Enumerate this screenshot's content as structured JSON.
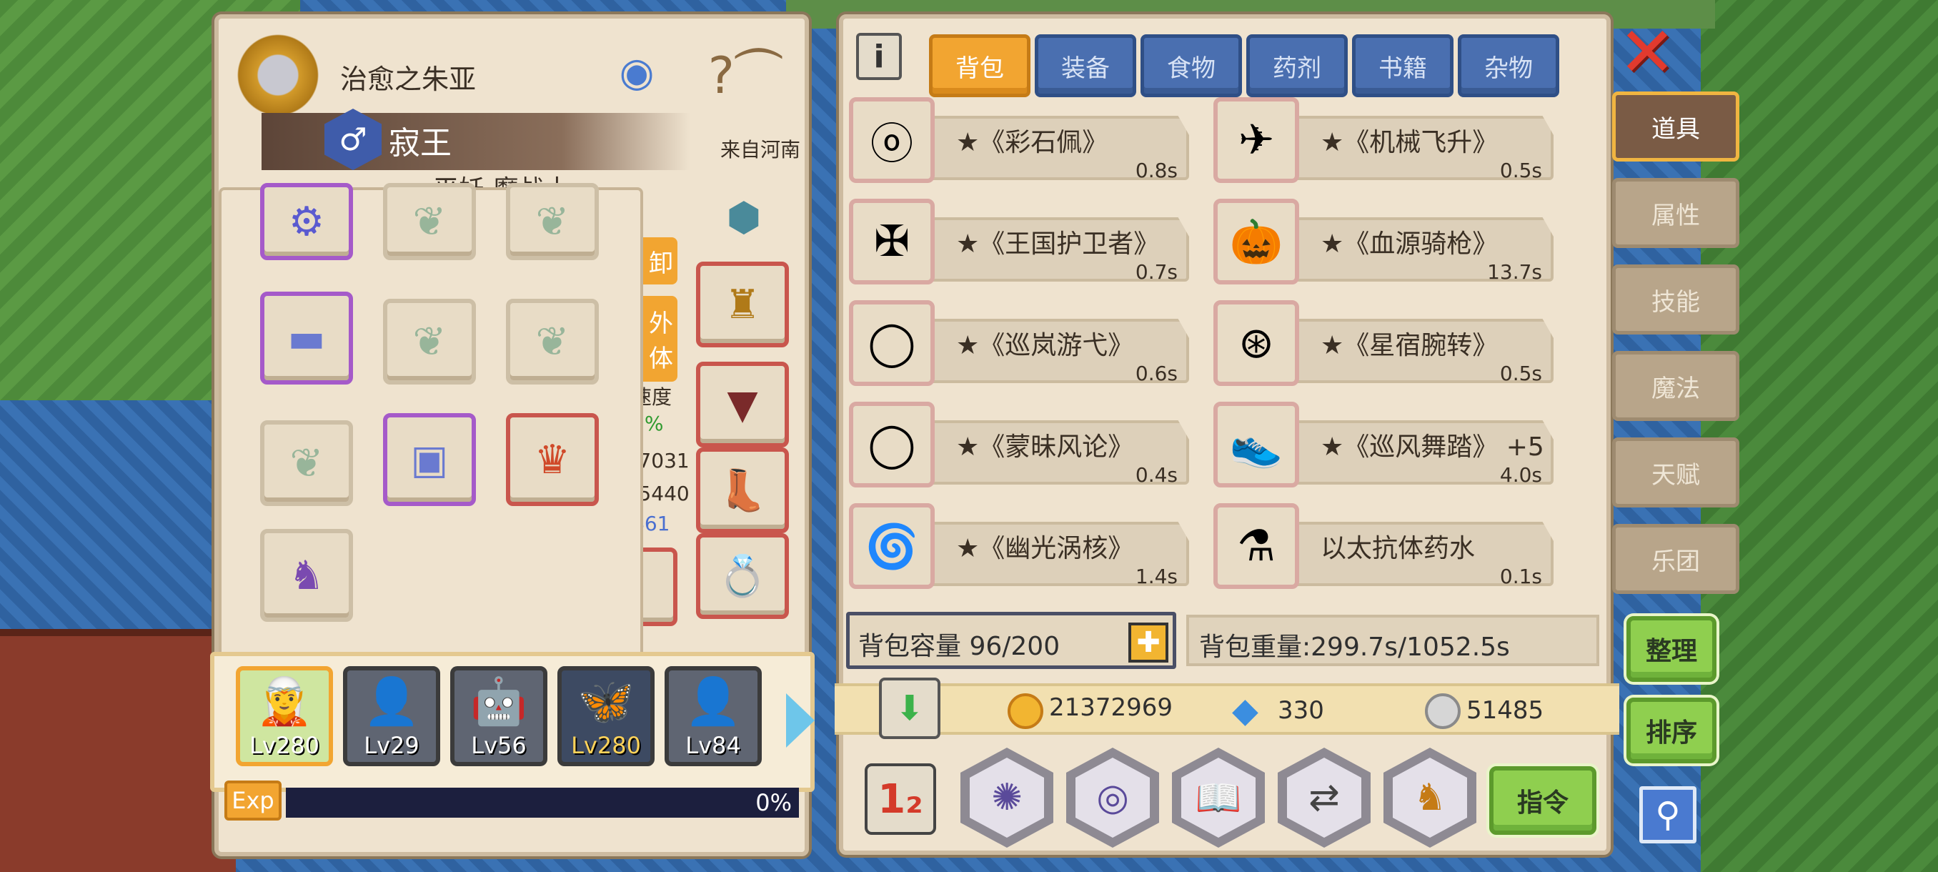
{
  "character": {
    "name": "治愈之朱亚",
    "title": "寂王",
    "origin": "来自河南",
    "class_partial": "平妖 魔战士",
    "unload_partial": "卸",
    "appearance_partial": "外\n体",
    "speed_partial": "速度",
    "percent_partial": "7%",
    "stat1_partial": "/7031",
    "stat2_partial": "/5440",
    "stat3_partial": "461"
  },
  "team": [
    {
      "level": "Lv280",
      "selected": true
    },
    {
      "level": "Lv29"
    },
    {
      "level": "Lv56"
    },
    {
      "level": "Lv280",
      "gold": true
    },
    {
      "level": "Lv84"
    }
  ],
  "exp": {
    "label": "Exp",
    "percent_text": "0%",
    "fraction": 0.0
  },
  "tabs": [
    "背包",
    "装备",
    "食物",
    "药剂",
    "书籍",
    "杂物"
  ],
  "active_tab": 0,
  "items": [
    {
      "name": "★《彩石佩》",
      "time": "0.8s",
      "icon": "necklace-icon"
    },
    {
      "name": "★《机械飞升》",
      "time": "0.5s",
      "icon": "mech-wing-icon"
    },
    {
      "name": "★《王国护卫者》",
      "time": "0.7s",
      "icon": "crossbow-icon"
    },
    {
      "name": "★《血源骑枪》",
      "time": "13.7s",
      "icon": "pumpkin-lance-icon"
    },
    {
      "name": "★《巡岚游弋》",
      "time": "0.6s",
      "icon": "ring-icon"
    },
    {
      "name": "★《星宿腕转》",
      "time": "0.5s",
      "icon": "bracer-icon"
    },
    {
      "name": "★《蒙昧风论》",
      "time": "0.4s",
      "icon": "ring-icon"
    },
    {
      "name": "★《巡风舞踏》 +5",
      "time": "4.0s",
      "icon": "boots-icon"
    },
    {
      "name": "★《幽光涡核》",
      "time": "1.4s",
      "icon": "vortex-core-icon"
    },
    {
      "name": "以太抗体药水",
      "time": "0.1s",
      "icon": "potion-icon"
    }
  ],
  "capacity": {
    "label": "背包容量 96/200"
  },
  "weight": {
    "label": "背包重量:299.7s/1052.5s"
  },
  "currency": {
    "gold": "21372969",
    "gems": "330",
    "silver": "51485"
  },
  "side_tabs": [
    "道具",
    "属性",
    "技能",
    "魔法",
    "天赋",
    "乐团"
  ],
  "buttons": {
    "organize": "整理",
    "sort": "排序",
    "command": "指令",
    "close": "✕",
    "info": "i"
  },
  "colors": {
    "accent": "#f2a531",
    "tab_blue": "#4a6fb0",
    "panel": "#efe3cf",
    "green_btn": "#8fcf4f",
    "close_red": "#e23a2e"
  }
}
